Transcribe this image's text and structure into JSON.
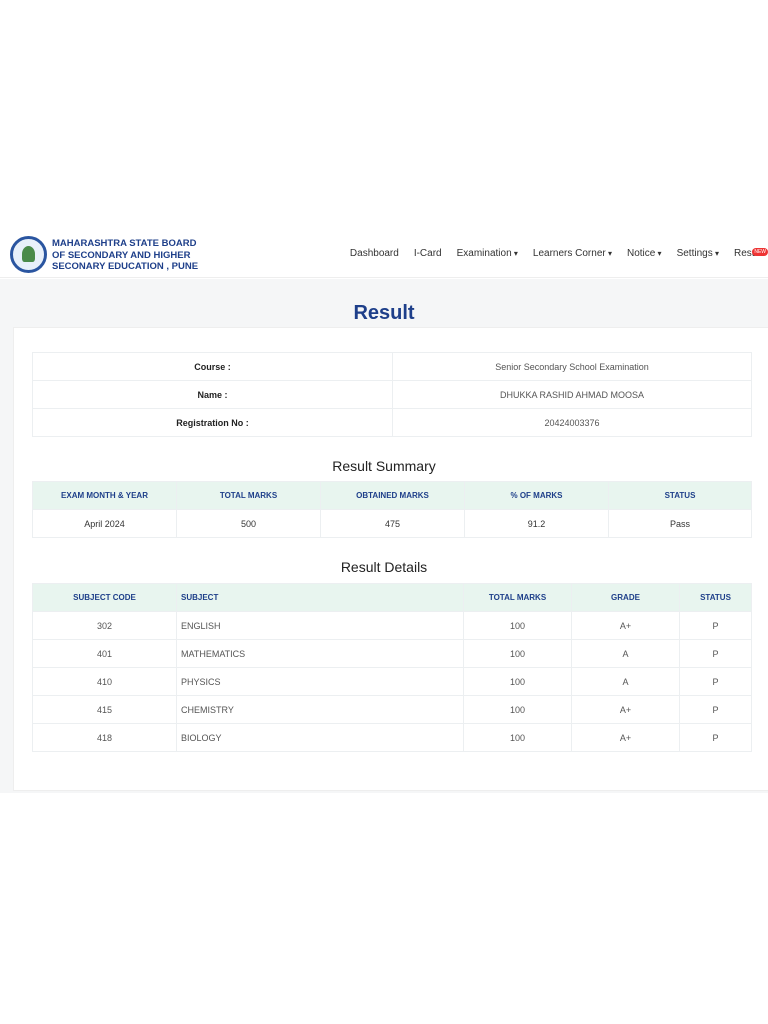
{
  "header": {
    "brand_lines": [
      "MAHARASHTRA STATE BOARD",
      "OF SECONDARY AND HIGHER",
      "SECONARY EDUCATION , PUNE"
    ],
    "nav": [
      {
        "label": "Dashboard"
      },
      {
        "label": "I-Card"
      },
      {
        "label": "Examination",
        "dropdown": true
      },
      {
        "label": "Learners Corner",
        "dropdown": true
      },
      {
        "label": "Notice",
        "dropdown": true
      },
      {
        "label": "Settings",
        "dropdown": true
      },
      {
        "label": "Result"
      }
    ],
    "new_badge": "NEW"
  },
  "page_title": "Result",
  "info": [
    {
      "label": "Course :",
      "value": "Senior Secondary School Examination"
    },
    {
      "label": "Name :",
      "value": "DHUKKA RASHID AHMAD MOOSA"
    },
    {
      "label": "Registration No :",
      "value": "20424003376"
    }
  ],
  "summary": {
    "title": "Result Summary",
    "headers": [
      "EXAM MONTH & YEAR",
      "TOTAL MARKS",
      "OBTAINED MARKS",
      "% OF MARKS",
      "STATUS"
    ],
    "row": [
      "April 2024",
      "500",
      "475",
      "91.2",
      "Pass"
    ]
  },
  "details": {
    "title": "Result Details",
    "headers": [
      "SUBJECT CODE",
      "SUBJECT",
      "TOTAL MARKS",
      "GRADE",
      "STATUS"
    ],
    "rows": [
      [
        "302",
        "ENGLISH",
        "100",
        "A+",
        "P"
      ],
      [
        "401",
        "MATHEMATICS",
        "100",
        "A",
        "P"
      ],
      [
        "410",
        "PHYSICS",
        "100",
        "A",
        "P"
      ],
      [
        "415",
        "CHEMISTRY",
        "100",
        "A+",
        "P"
      ],
      [
        "418",
        "BIOLOGY",
        "100",
        "A+",
        "P"
      ]
    ]
  }
}
